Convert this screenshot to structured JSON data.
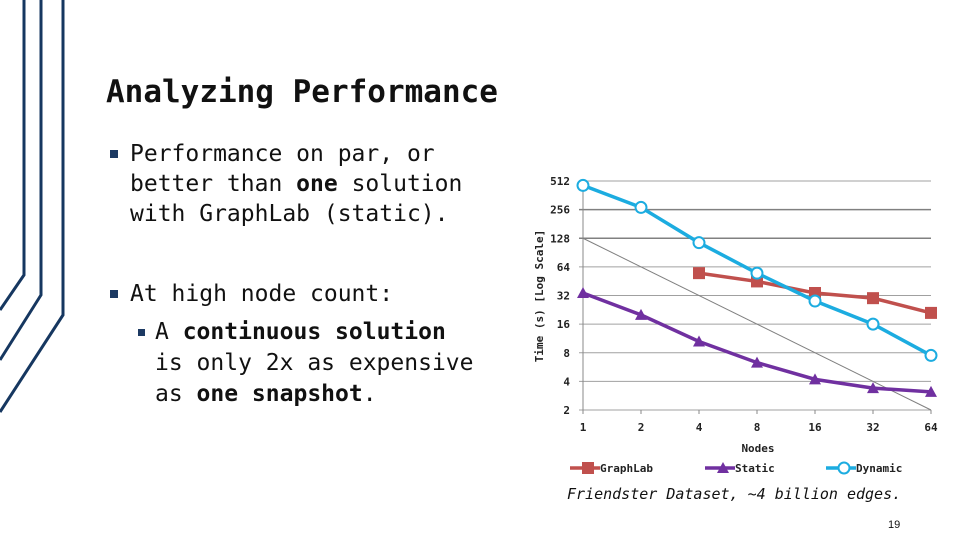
{
  "slide": {
    "title": "Analyzing Performance",
    "bullets": [
      {
        "lines": [
          [
            "Performance on par, or"
          ],
          [
            "better than ",
            {
              "b": "one"
            },
            " solution"
          ],
          [
            "with GraphLab (static)."
          ]
        ]
      },
      {
        "lines": [
          [
            "At high node count:"
          ]
        ],
        "sub": [
          {
            "lines": [
              [
                "A ",
                {
                  "b": "continuous solution"
                }
              ],
              [
                "is only 2x as expensive"
              ],
              [
                "as ",
                {
                  "b": "one snapshot"
                },
                "."
              ]
            ]
          }
        ]
      }
    ],
    "caption": "Friendster Dataset, ~4 billion edges.",
    "page_number": "19",
    "accent_color": "#1d3a63"
  },
  "chart_data": {
    "type": "line",
    "title": "",
    "xlabel": "Nodes",
    "ylabel": "Time (s) [Log Scale]",
    "x": [
      1,
      2,
      4,
      8,
      16,
      32,
      64
    ],
    "x_ticks": [
      "1",
      "2",
      "4",
      "8",
      "16",
      "32",
      "64"
    ],
    "y_ticks": [
      "2",
      "4",
      "8",
      "16",
      "32",
      "64",
      "128",
      "256",
      "512"
    ],
    "ylim": [
      2,
      512
    ],
    "y_scale": "log2",
    "x_scale": "log2",
    "grid": "horizontal",
    "legend": "bottom",
    "series": [
      {
        "name": "GraphLab",
        "color": "#c0504d",
        "marker": "square",
        "values": [
          null,
          null,
          55,
          45,
          34,
          30,
          21
        ]
      },
      {
        "name": "Static",
        "color": "#7030a0",
        "marker": "triangle",
        "values": [
          34,
          20,
          10.5,
          6.3,
          4.2,
          3.4,
          3.1
        ]
      },
      {
        "name": "Dynamic",
        "color": "#1cace0",
        "marker": "circle",
        "values": [
          460,
          270,
          115,
          55,
          28,
          16,
          7.5
        ]
      }
    ],
    "reference_line": {
      "color": "#808080",
      "values": [
        128,
        64,
        32,
        16,
        8,
        4,
        2
      ]
    }
  }
}
